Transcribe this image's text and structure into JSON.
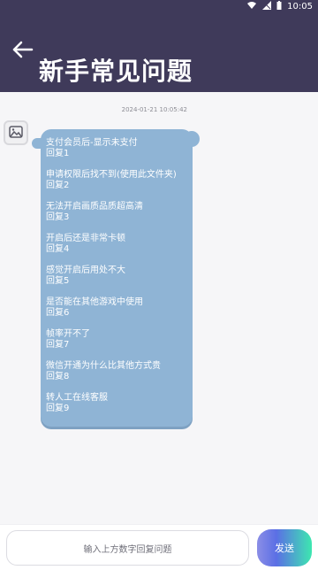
{
  "status_bar": {
    "time": "10:05"
  },
  "header": {
    "title": "新手常见问题"
  },
  "chat": {
    "timestamp": "2024-01-21 10:05:42",
    "items": [
      {
        "question": "支付会员后-显示未支付",
        "reply": "回复1"
      },
      {
        "question": "申请权限后找不到(使用此文件夹)",
        "reply": "回复2"
      },
      {
        "question": "无法开启画质品质超高清",
        "reply": "回复3"
      },
      {
        "question": "开启后还是非常卡顿",
        "reply": "回复4"
      },
      {
        "question": "感觉开启后用处不大",
        "reply": "回复5"
      },
      {
        "question": "是否能在其他游戏中使用",
        "reply": "回复6"
      },
      {
        "question": "帧率开不了",
        "reply": "回复7"
      },
      {
        "question": "微信开通为什么比其他方式贵",
        "reply": "回复8"
      },
      {
        "question": "转人工在线客服",
        "reply": "回复9"
      }
    ]
  },
  "input": {
    "placeholder": "输入上方数字回复问题"
  },
  "send_button": {
    "label": "发送"
  },
  "colors": {
    "header_bg": "#3f3a5a",
    "bubble_bg": "#8fb4d5",
    "send_gradient_start": "#8b8ee6",
    "send_gradient_end": "#3de7b0"
  },
  "icons": [
    "wifi-icon",
    "signal-icon",
    "battery-icon",
    "back-arrow-icon",
    "image-placeholder-icon"
  ]
}
